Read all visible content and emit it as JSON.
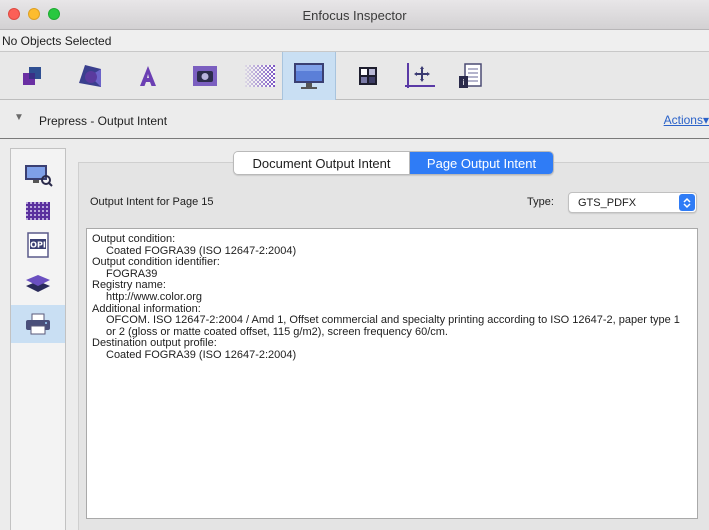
{
  "window": {
    "title": "Enfocus Inspector"
  },
  "selection_status": "No Objects Selected",
  "toolbar": {
    "tools": [
      {
        "name": "object-properties-icon"
      },
      {
        "name": "fill-stroke-icon"
      },
      {
        "name": "text-icon"
      },
      {
        "name": "image-icon"
      },
      {
        "name": "transparency-icon"
      },
      {
        "name": "prepress-monitor-icon",
        "active": true
      },
      {
        "name": "separation-icon"
      },
      {
        "name": "position-icon"
      },
      {
        "name": "document-info-icon"
      }
    ]
  },
  "panel": {
    "title": "Prepress - Output Intent",
    "actions_label": "Actions"
  },
  "sidebar": {
    "items": [
      {
        "name": "preview-icon"
      },
      {
        "name": "halftone-icon"
      },
      {
        "name": "opi-icon",
        "label": "OPI"
      },
      {
        "name": "layers-icon"
      },
      {
        "name": "printer-icon",
        "active": true
      }
    ]
  },
  "tabs": {
    "document": "Document Output Intent",
    "page": "Page Output Intent",
    "selected": "page"
  },
  "page_label": "Output Intent for Page 15",
  "type": {
    "label": "Type:",
    "value": "GTS_PDFX"
  },
  "details": {
    "output_condition_label": "Output condition:",
    "output_condition": "Coated FOGRA39 (ISO 12647-2:2004)",
    "identifier_label": "Output condition identifier:",
    "identifier": "FOGRA39",
    "registry_label": "Registry name:",
    "registry": "http://www.color.org",
    "additional_label": "Additional information:",
    "additional": "OFCOM. ISO 12647-2:2004 / Amd 1, Offset commercial and specialty printing according to ISO 12647-2, paper type 1 or 2 (gloss or matte coated offset, 115 g/m2), screen frequency 60/cm.",
    "profile_label": "Destination output profile:",
    "profile": "Coated FOGRA39 (ISO 12647-2:2004)"
  },
  "colors": {
    "accent": "#2f7cf6",
    "selected_bg": "#c9dff3",
    "link": "#2a62c9"
  }
}
